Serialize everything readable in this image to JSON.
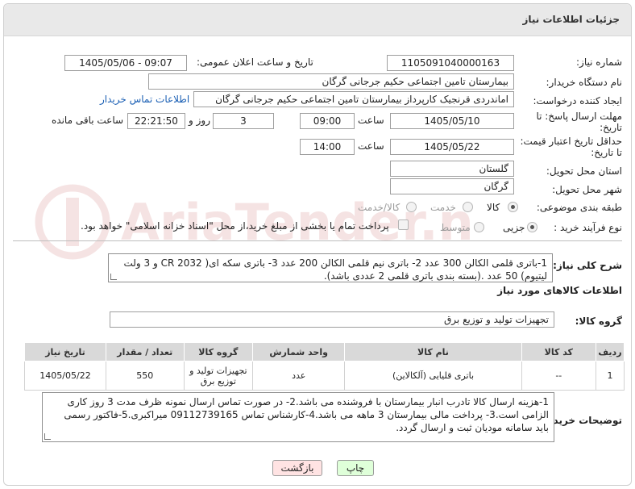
{
  "header": {
    "title": "جزئیات اطلاعات نیاز"
  },
  "fields": {
    "need_number": {
      "label": "شماره نیاز:",
      "value": "1105091040000163"
    },
    "announce_datetime": {
      "label": "تاریخ و ساعت اعلان عمومی:",
      "value": "1405/05/06 - 09:07"
    },
    "buyer_org": {
      "label": "نام دستگاه خریدار:",
      "value": "بیمارستان تامین اجتماعی حکیم جرجانی گرگان"
    },
    "requester": {
      "label": "ایجاد کننده درخواست:",
      "value": "اماندردی قرنجیک کارپرداز بیمارستان تامین اجتماعی حکیم جرجانی گرگان",
      "contact_link": "اطلاعات تماس خریدار"
    },
    "reply_deadline": {
      "label_line1": "مهلت ارسال پاسخ: تا",
      "label_line2": "تاریخ:",
      "date": "1405/05/10",
      "time_label": "ساعت",
      "time": "09:00",
      "days": "3",
      "days_label": "روز و",
      "remaining": "22:21:50",
      "remaining_label": "ساعت باقی مانده"
    },
    "price_validity": {
      "label_line1": "حداقل تاریخ اعتبار قیمت:",
      "label_line2": "تا تاریخ:",
      "date": "1405/05/22",
      "time_label": "ساعت",
      "time": "14:00"
    },
    "province": {
      "label": "استان محل تحویل:",
      "value": "گلستان"
    },
    "city": {
      "label": "شهر محل تحویل:",
      "value": "گرگان"
    },
    "category": {
      "label": "طبقه بندی موضوعی:",
      "options": [
        "کالا",
        "خدمت",
        "کالا/خدمت"
      ],
      "selected": 0
    },
    "process_type": {
      "label": "نوع فرآیند خرید :",
      "options": [
        "جزیی",
        "متوسط"
      ],
      "selected": 0,
      "payment_note": "پرداخت تمام یا بخشی از مبلغ خرید،از محل \"اسناد خزانه اسلامی\" خواهد بود."
    }
  },
  "description": {
    "label": "شرح کلی نیاز:",
    "text": "1-باتری قلمی الکالن  300 عدد 2- باتری نیم قلمی الکالن 200 عدد  3- باتری سکه ای( CR 2032 و 3 ولت لیتیوم)  50 عدد .(بسته بندی باتری قلمی 2 عددی باشد)."
  },
  "goods_info": {
    "title": "اطلاعات کالاهای مورد نیاز",
    "group_label": "گروه کالا:",
    "group_value": "تجهیزات تولید و توزیع برق",
    "columns": [
      "ردیف",
      "کد کالا",
      "نام کالا",
      "واحد شمارش",
      "گروه کالا",
      "تعداد / مقدار",
      "تاریخ نیاز"
    ],
    "rows": [
      [
        "1",
        "--",
        "باتری قلیایی (آلکالاین)",
        "عدد",
        "تجهیزات تولید و توزیع برق",
        "550",
        "1405/05/22"
      ]
    ]
  },
  "buyer_notes": {
    "label": "توضیحات خریدار:",
    "text": "1-هزینه ارسال کالا تادرب انبار بیمارستان با فروشنده می باشد.2- در صورت تماس ارسال نمونه ظرف مدت 3 روز کاری الزامی است.3- پرداخت مالی بیمارستان 3 ماهه می باشد.4-کارشناس تماس 09112739165 میراکبری.5-فاکتور رسمی باید سامانه مودیان ثبت و ارسال گردد."
  },
  "buttons": {
    "print": "چاپ",
    "back": "بازگشت"
  },
  "watermark": {
    "text": "AriaTender.net"
  },
  "colors": {
    "header_bg": "#e9e9e9",
    "link": "#1a5fb4",
    "table_head": "#d9d9d9",
    "print_btn": "#dfffd9",
    "back_btn": "#ffe3e3"
  }
}
